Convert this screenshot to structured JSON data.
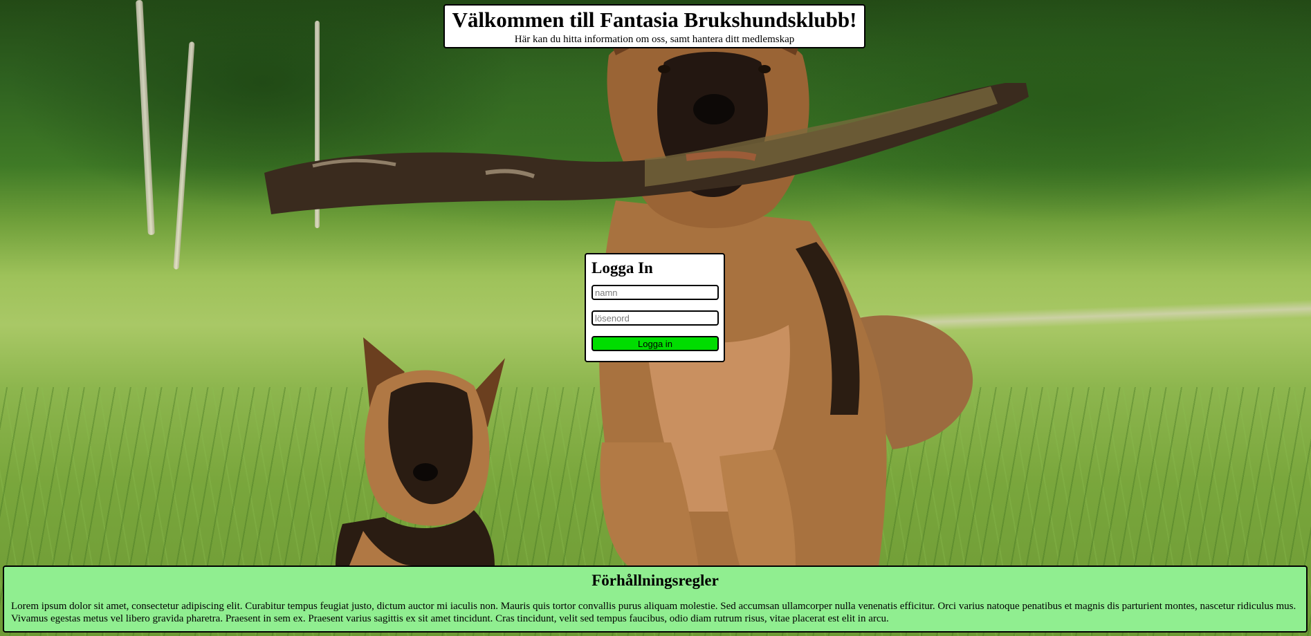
{
  "header": {
    "title": "Välkommen till Fantasia Brukshundsklubb!",
    "subtitle": "Här kan du hitta information om oss, samt hantera ditt medlemskap"
  },
  "login": {
    "title": "Logga In",
    "name_placeholder": "namn",
    "password_placeholder": "lösenord",
    "submit_label": "Logga in",
    "button_color": "#00dd00"
  },
  "rules": {
    "title": "Förhållningsregler",
    "text": "Lorem ipsum dolor sit amet, consectetur adipiscing elit. Curabitur tempus feugiat justo, dictum auctor mi iaculis non. Mauris quis tortor convallis purus aliquam molestie. Sed accumsan ullamcorper nulla venenatis efficitur. Orci varius natoque penatibus et magnis dis parturient montes, nascetur ridiculus mus. Vivamus egestas metus vel libero gravida pharetra. Praesent in sem ex. Praesent varius sagittis ex sit amet tincidunt. Cras tincidunt, velit sed tempus faucibus, odio diam rutrum risus, vitae placerat est elit in arcu.",
    "background_color": "#90ee90"
  },
  "background": {
    "subject": "two German Shepherd dogs running in grass, adult carrying a large stick"
  }
}
